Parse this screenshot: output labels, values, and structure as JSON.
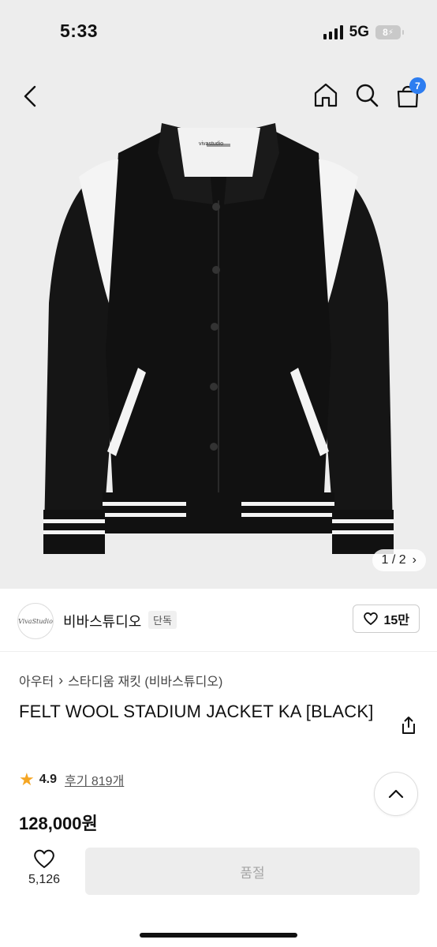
{
  "status_bar": {
    "time": "5:33",
    "network": "5G",
    "battery": "8"
  },
  "nav": {
    "cart_count": "7"
  },
  "gallery": {
    "counter": "1 / 2",
    "brand_label_on_tag": "vivastudio"
  },
  "brand": {
    "logo_text": "VivaStudio",
    "name": "비바스튜디오",
    "tag": "단독",
    "like_count": "15만"
  },
  "breadcrumb": {
    "parent": "아우터",
    "child": "스타디움 재킷 (비바스튜디오)"
  },
  "product": {
    "title": "FELT WOOL STADIUM JACKET KA [BLACK]",
    "rating": "4.9",
    "review_text": "후기 819개",
    "price": "128,000원"
  },
  "bottom": {
    "wish_count": "5,126",
    "action_label": "품절"
  },
  "colors": {
    "accent": "#2d7df0",
    "star": "#f5a623",
    "soldout_bg": "#ededed"
  }
}
